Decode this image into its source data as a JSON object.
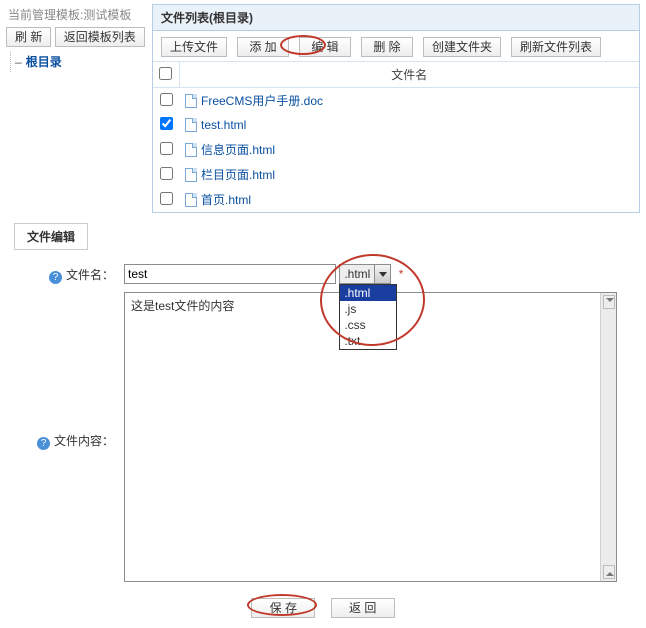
{
  "nav": {
    "template_label_prefix": "当前管理模板:",
    "template_name": "测试模板",
    "refresh_label": "刷 新",
    "back_label": "返回模板列表",
    "root_label": "根目录"
  },
  "file_list": {
    "heading_prefix": "文件列表",
    "heading_context": "(根目录)",
    "toolbar": {
      "upload": "上传文件",
      "add": "添 加",
      "edit": "编 辑",
      "delete": "删 除",
      "create_folder": "创建文件夹",
      "refresh_list": "刷新文件列表"
    },
    "column_header": "文件名",
    "rows": [
      {
        "name": "FreeCMS用户手册.doc",
        "checked": false
      },
      {
        "name": "test.html",
        "checked": true
      },
      {
        "name": "信息页面.html",
        "checked": false
      },
      {
        "name": "栏目页面.html",
        "checked": false
      },
      {
        "name": "首页.html",
        "checked": false
      }
    ]
  },
  "editor": {
    "section_title": "文件编辑",
    "labels": {
      "filename": "文件名：",
      "content": "文件内容："
    },
    "filename_value": "test",
    "extension_selected": ".html",
    "required_mark": "*",
    "extension_options": [
      ".html",
      ".js",
      ".css",
      ".txt"
    ],
    "content_value": "这是test文件的内容",
    "save_label": "保 存",
    "back_label": "返 回"
  }
}
